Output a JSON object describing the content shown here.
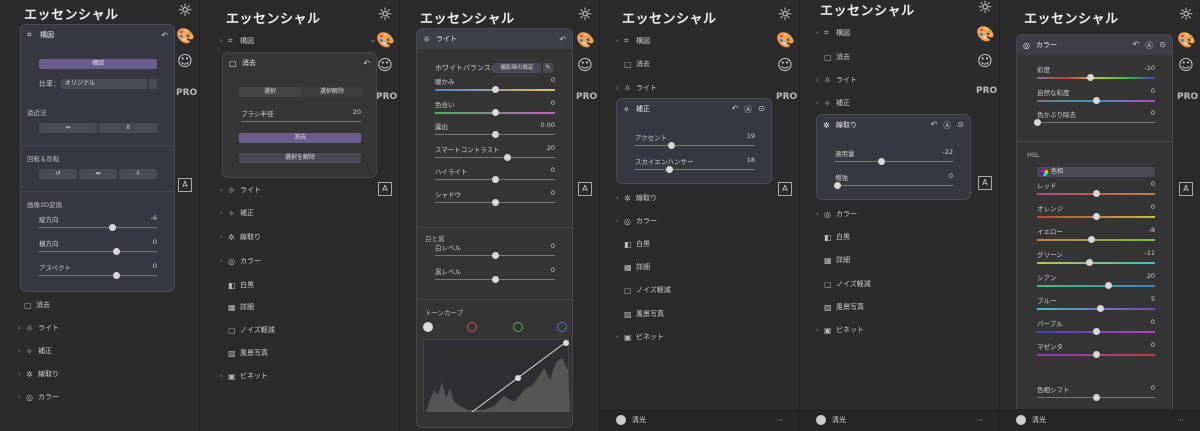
{
  "app_title": "エッセンシャル",
  "rail": {
    "sun_icon": "☼",
    "palette_icon": "🎨",
    "smile_icon": "☺",
    "pro": "PRO",
    "a_icon": "A"
  },
  "c1": {
    "panel_title": "構図",
    "crop_btn": "構図",
    "ratio_label": "比率：",
    "ratio_value": "オリジナル",
    "persp": "遠近法",
    "rotate": "回転＆反転",
    "transform3d": "画像3D変換",
    "sliders": [
      {
        "label": "縦方向",
        "value": "-6",
        "pos": 0.47
      },
      {
        "label": "横方向",
        "value": "0",
        "pos": 0.5
      },
      {
        "label": "アスペクト",
        "value": "0",
        "pos": 0.5
      }
    ],
    "items": [
      "消去",
      "ライト",
      "補正",
      "線取り",
      "カラー"
    ]
  },
  "c2": {
    "items_top": [
      "構図"
    ],
    "panel_title": "消去",
    "tab_select": "選択",
    "tab_unselect": "選択解除",
    "brush_label": "ブラシ半径",
    "brush_value": "20",
    "erase_btn": "消去",
    "clear_btn": "選択を解除",
    "items": [
      "ライト",
      "補正",
      "線取り",
      "カラー",
      "白黒",
      "詳細",
      "ノイズ軽減",
      "風景写真",
      "ビネット"
    ]
  },
  "c3": {
    "panel_title": "ライト",
    "wb_label": "ホワイトバランス:",
    "wb_value": "撮影時の設定",
    "sliders": [
      {
        "label": "暖かみ",
        "value": "0",
        "pos": 0.5
      },
      {
        "label": "色合い",
        "value": "0",
        "pos": 0.5
      },
      {
        "label": "露出",
        "value": "0.00",
        "pos": 0.5
      },
      {
        "label": "スマートコントラスト",
        "value": "20",
        "pos": 0.6
      },
      {
        "label": "ハイライト",
        "value": "0",
        "pos": 0.5
      },
      {
        "label": "シャドウ",
        "value": "0",
        "pos": 0.5
      }
    ],
    "bw_section": "白と黒",
    "bw_sliders": [
      {
        "label": "白レベル",
        "value": "0",
        "pos": 0.5
      },
      {
        "label": "黒レベル",
        "value": "0",
        "pos": 0.5
      }
    ],
    "curve_section": "トーンカーブ"
  },
  "c4": {
    "items_top": [
      "構図",
      "消去",
      "ライト"
    ],
    "panel_title": "補正",
    "sliders": [
      {
        "label": "アクセント",
        "value": "19",
        "pos": 0.3
      },
      {
        "label": "スカイエンハンサー",
        "value": "18",
        "pos": 0.28
      }
    ],
    "items": [
      "線取り",
      "カラー",
      "白黒",
      "詳細",
      "ノイズ軽減",
      "風景写真",
      "ビネット"
    ],
    "bottom_name": "清光"
  },
  "c5": {
    "items_top": [
      "構図",
      "消去",
      "ライト",
      "補正"
    ],
    "panel_title": "線取り",
    "sliders": [
      {
        "label": "適用量",
        "value": "-22",
        "pos": 0.39
      },
      {
        "label": "増強",
        "value": "0",
        "pos": 0.02
      }
    ],
    "items": [
      "カラー",
      "白黒",
      "詳細",
      "ノイズ軽減",
      "風景写真",
      "ビネット"
    ],
    "bottom_name": "清光"
  },
  "c6": {
    "panel_title": "カラー",
    "sliders": [
      {
        "label": "彩度",
        "value": "-10",
        "pos": 0.45
      },
      {
        "label": "自然な彩度",
        "value": "0",
        "pos": 0.5
      },
      {
        "label": "色かぶり除去",
        "value": "0",
        "pos": 0.0
      }
    ],
    "hsl": "HSL",
    "hsl_select": "色相",
    "hsl_sliders": [
      {
        "label": "レッド",
        "value": "0",
        "pos": 0.5
      },
      {
        "label": "オレンジ",
        "value": "0",
        "pos": 0.5
      },
      {
        "label": "イエロー",
        "value": "-8",
        "pos": 0.46
      },
      {
        "label": "グリーン",
        "value": "-11",
        "pos": 0.44
      },
      {
        "label": "シアン",
        "value": "20",
        "pos": 0.6
      },
      {
        "label": "ブルー",
        "value": "5",
        "pos": 0.53
      },
      {
        "label": "パープル",
        "value": "0",
        "pos": 0.5
      },
      {
        "label": "マゼンタ",
        "value": "0",
        "pos": 0.5
      }
    ],
    "hue_shift": "色相シフト",
    "hue_shift_value": "0",
    "bottom_name": "清光"
  }
}
